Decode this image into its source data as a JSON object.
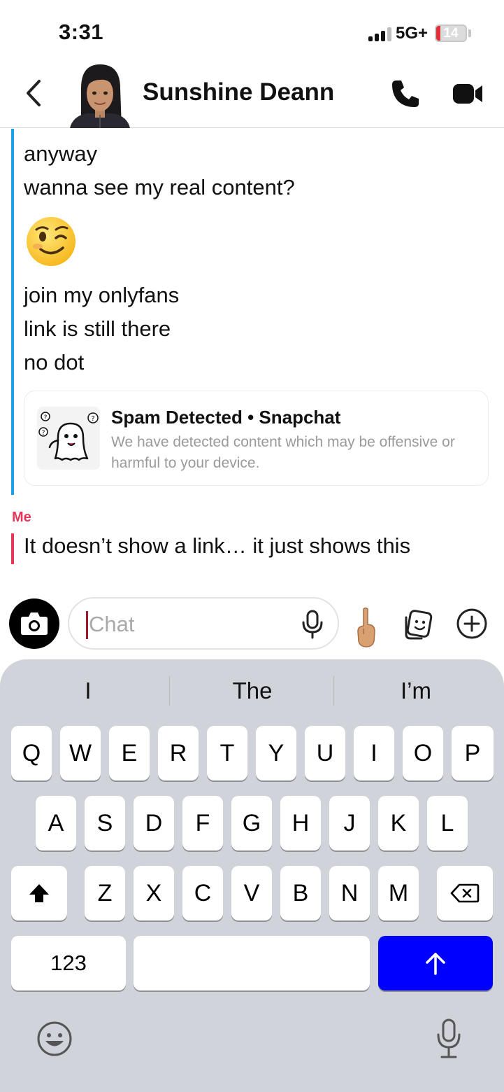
{
  "status_bar": {
    "time": "3:31",
    "network": "5G+",
    "battery": "14",
    "battery_level_percent": 14
  },
  "header": {
    "contact_name": "Sunshine Deann",
    "icons": [
      "back-icon",
      "bitmoji-avatar",
      "phone-icon",
      "video-camera-icon"
    ]
  },
  "chat": {
    "sender_color": "#1aa2e8",
    "me_color": "#e8365a",
    "messages_them": [
      "anyway",
      "wanna see my real content?",
      "join my onlyfans",
      "link is still there",
      "no dot"
    ],
    "emoji": "winking-face",
    "spam_card": {
      "title": "Spam Detected • Snapchat",
      "description": "We have detected content which may be offensive or harmful to your device.",
      "icon": "confused-ghost-icon"
    },
    "me_label": "Me",
    "me_message": "It doesn’t show a link… it just shows this"
  },
  "composer": {
    "placeholder": "Chat",
    "icons": [
      "camera-icon",
      "microphone-icon",
      "pointing-finger-icon",
      "sticker-icon",
      "plus-icon"
    ]
  },
  "keyboard": {
    "suggestions": [
      "I",
      "The",
      "I’m"
    ],
    "row1": [
      "Q",
      "W",
      "E",
      "R",
      "T",
      "Y",
      "U",
      "I",
      "O",
      "P"
    ],
    "row2": [
      "A",
      "S",
      "D",
      "F",
      "G",
      "H",
      "J",
      "K",
      "L"
    ],
    "row3": [
      "Z",
      "X",
      "C",
      "V",
      "B",
      "N",
      "M"
    ],
    "numbers_key": "123",
    "send_color": "#0000ff",
    "icons": [
      "shift-icon",
      "backspace-icon",
      "send-arrow-icon",
      "emoji-icon",
      "dictation-mic-icon"
    ]
  }
}
